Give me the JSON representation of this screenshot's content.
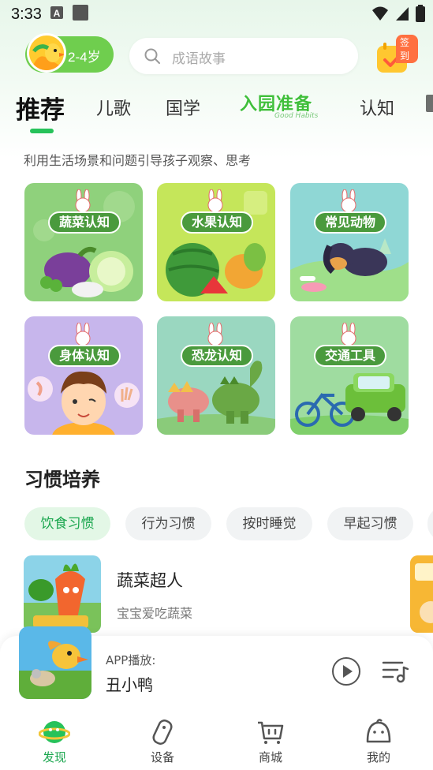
{
  "status_bar": {
    "time": "3:33"
  },
  "header": {
    "age_label": "2-4岁",
    "search_placeholder": "成语故事",
    "checkin_label": "签到"
  },
  "tabs": [
    {
      "label": "推荐",
      "active": true
    },
    {
      "label": "儿歌"
    },
    {
      "label": "国学"
    },
    {
      "label": "入园准备",
      "sub": "Good Habits"
    },
    {
      "label": "认知"
    }
  ],
  "recommend": {
    "subtitle": "利用生活场景和问题引导孩子观察、思考",
    "brand_badge": "兔",
    "cards": [
      {
        "title": "蔬菜认知",
        "bg": "#8fd17c"
      },
      {
        "title": "水果认知",
        "bg": "#c5e65a"
      },
      {
        "title": "常见动物",
        "bg": "#8fd7d5"
      },
      {
        "title": "身体认知",
        "bg": "#c7b6ec"
      },
      {
        "title": "恐龙认知",
        "bg": "#9ad7c0"
      },
      {
        "title": "交通工具",
        "bg": "#9fdca0"
      }
    ]
  },
  "habits": {
    "title": "习惯培养",
    "chips": [
      "饮食习惯",
      "行为习惯",
      "按时睡觉",
      "早起习惯"
    ],
    "active_chip": "饮食习惯",
    "item": {
      "title": "蔬菜超人",
      "subtitle": "宝宝爱吃蔬菜"
    }
  },
  "player": {
    "label": "APP播放:",
    "title": "丑小鸭"
  },
  "bottom_nav": [
    {
      "label": "发现",
      "icon": "planet-icon",
      "active": true
    },
    {
      "label": "设备",
      "icon": "device-icon"
    },
    {
      "label": "商城",
      "icon": "cart-icon"
    },
    {
      "label": "我的",
      "icon": "profile-icon"
    }
  ],
  "colors": {
    "accent": "#27c25a",
    "age_pill": "#6fce4e",
    "checkin": "#ffcb2f"
  }
}
